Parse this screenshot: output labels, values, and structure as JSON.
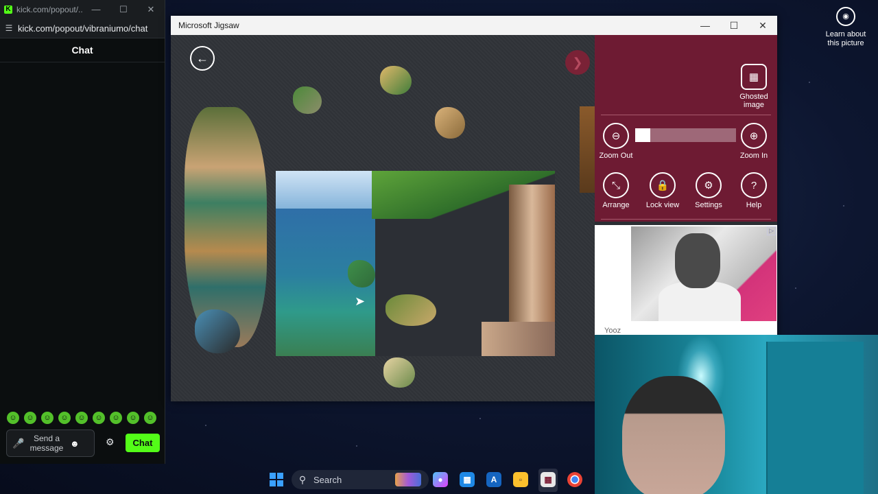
{
  "kick": {
    "tab_title": "kick.com/popout/...",
    "url": "kick.com/popout/vibraniumo/chat",
    "chat_header": "Chat",
    "input_placeholder": "Send a message",
    "chat_button": "Chat",
    "emote_count": 9
  },
  "jigsaw": {
    "window_title": "Microsoft Jigsaw",
    "panel": {
      "ghosted_label": "Ghosted image",
      "zoom_out_label": "Zoom Out",
      "zoom_in_label": "Zoom In",
      "zoom_level": 0.15,
      "arrange_label": "Arrange",
      "lock_label": "Lock view",
      "settings_label": "Settings",
      "help_label": "Help"
    },
    "ad": {
      "advertiser": "Yooz"
    }
  },
  "desktop": {
    "learn_text": "Learn about this picture"
  },
  "taskbar": {
    "search_text": "Search"
  }
}
